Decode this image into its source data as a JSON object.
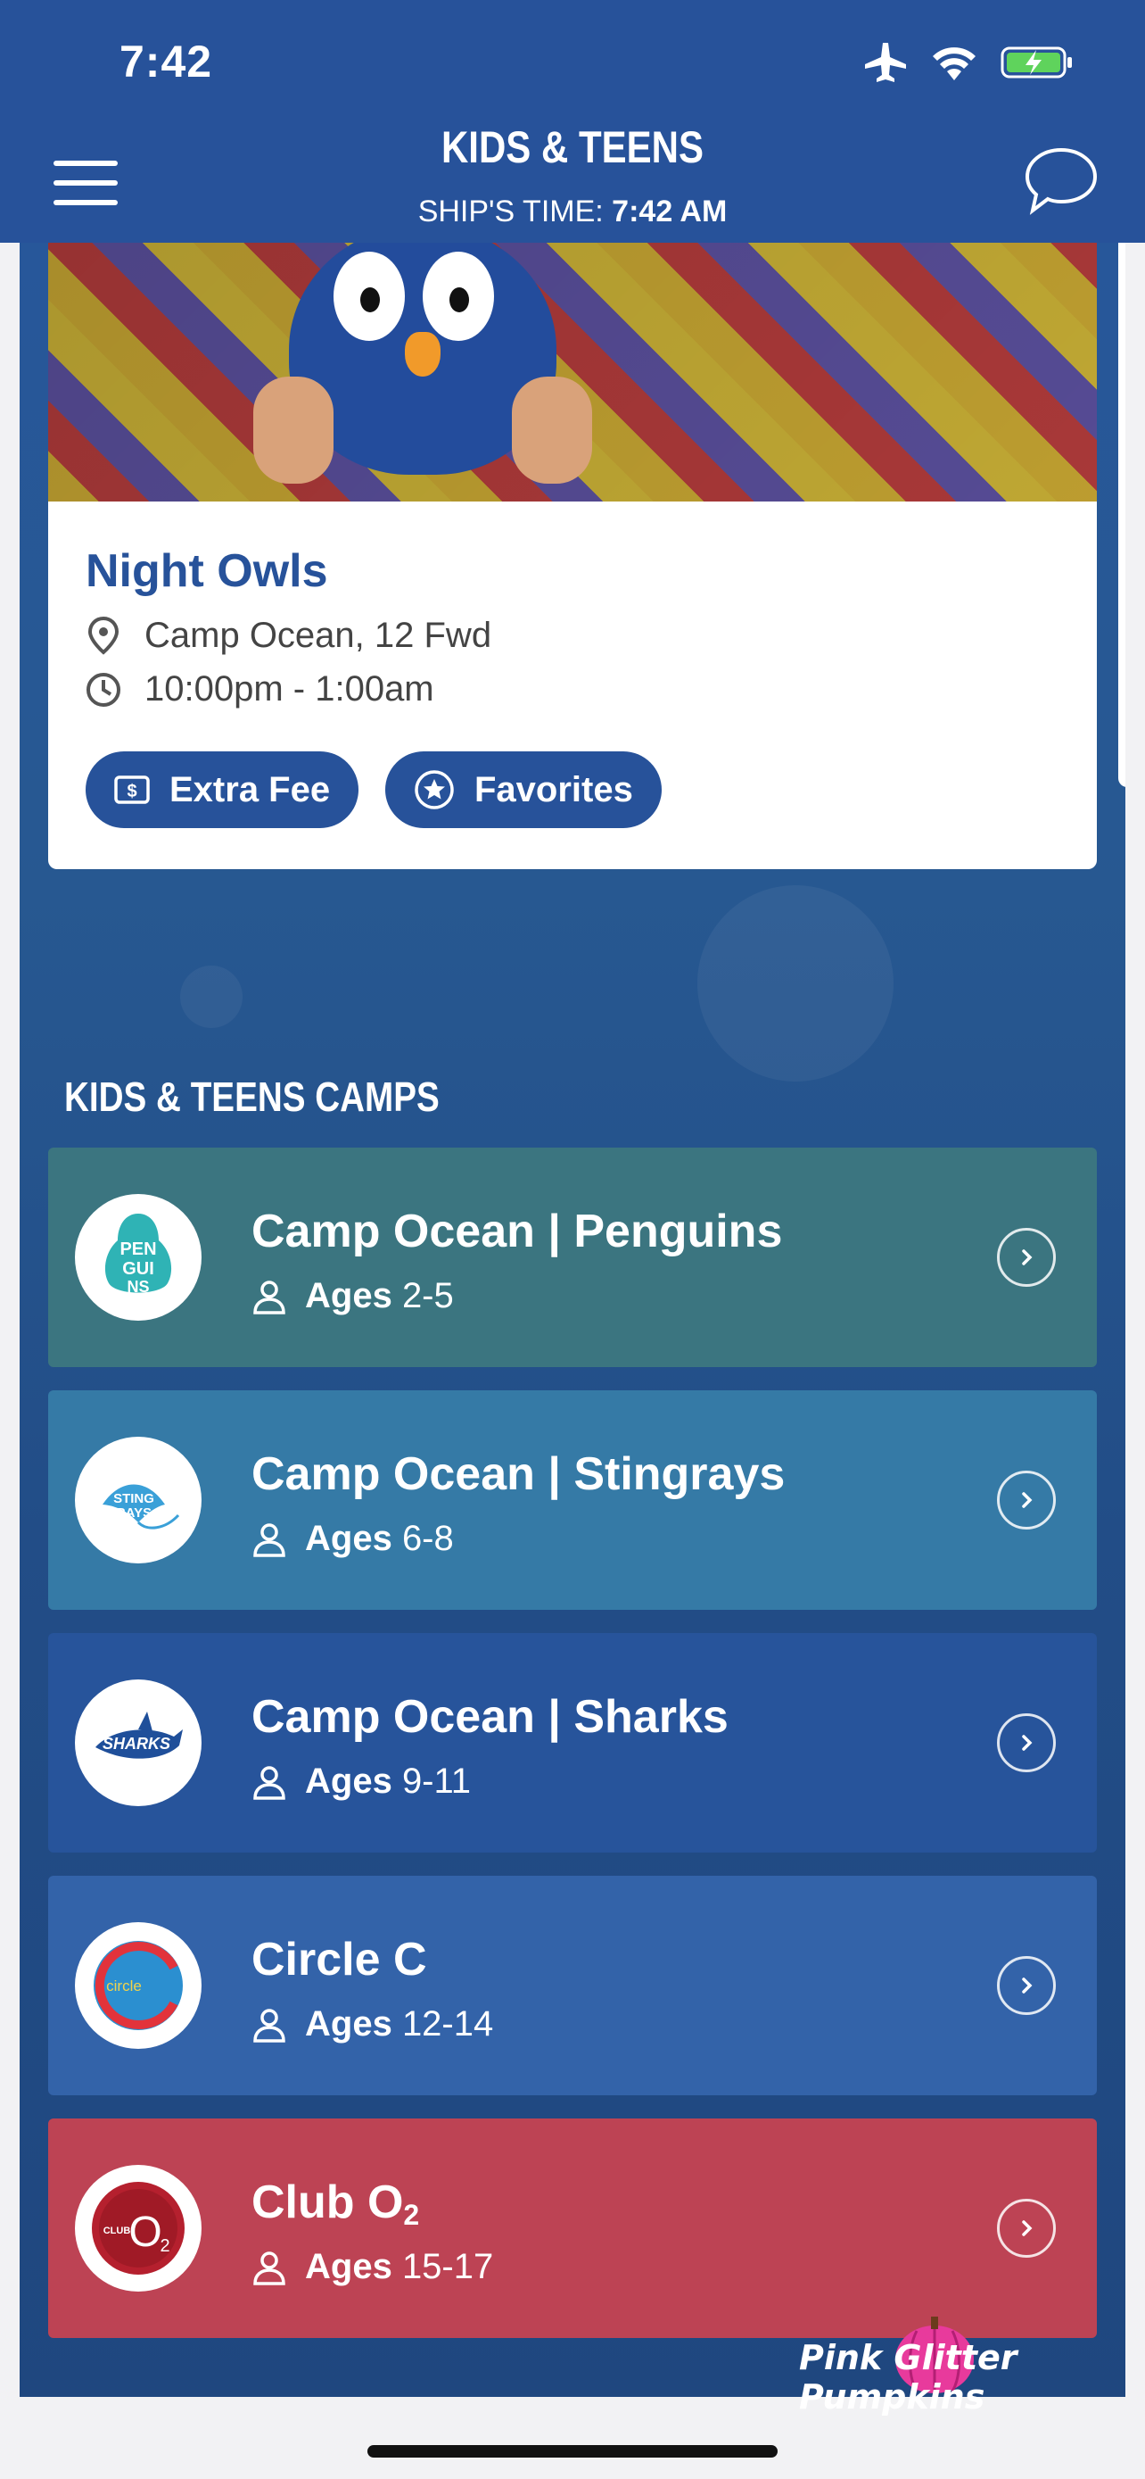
{
  "status_bar": {
    "time": "7:42"
  },
  "header": {
    "title": "KIDS & TEENS",
    "ship_time_label": "SHIP'S TIME:",
    "ship_time_value": "7:42 AM"
  },
  "event": {
    "title": "Night Owls",
    "location": "Camp Ocean, 12 Fwd",
    "time": "10:00pm - 1:00am",
    "buttons": {
      "extra_fee": "Extra Fee",
      "favorites": "Favorites"
    }
  },
  "camps_section": {
    "title": "KIDS & TEENS CAMPS",
    "ages_label": "Ages",
    "camps": [
      {
        "name": "Camp Ocean | Penguins",
        "ages": "2-5",
        "color": "#3b7580",
        "logo_text": "PENGUINS"
      },
      {
        "name": "Camp Ocean | Stingrays",
        "ages": "6-8",
        "color": "#357aa6",
        "logo_text": "STINGRAYS"
      },
      {
        "name": "Camp Ocean | Sharks",
        "ages": "9-11",
        "color": "#27549b",
        "logo_text": "SHARKS"
      },
      {
        "name": "Circle C",
        "ages": "12-14",
        "color": "#3363a9",
        "logo_text": "circle"
      },
      {
        "name": "Club O",
        "name_sub": "2",
        "ages": "15-17",
        "color": "#bd4354",
        "logo_text": "CLUB O2"
      }
    ]
  },
  "watermark": "Pink Glitter Pumpkins",
  "colors": {
    "header": "#27529a",
    "accent": "#27529a",
    "text_dark": "#444444"
  }
}
